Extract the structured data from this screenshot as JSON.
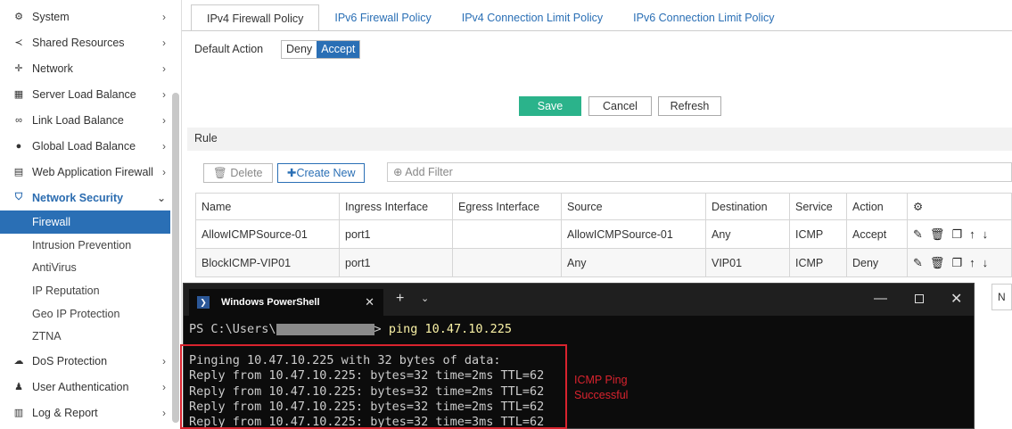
{
  "sidebar": {
    "items": [
      {
        "label": "System",
        "icon": "gear-icon"
      },
      {
        "label": "Shared Resources",
        "icon": "share-icon"
      },
      {
        "label": "Network",
        "icon": "network-icon"
      },
      {
        "label": "Server Load Balance",
        "icon": "server-load-icon"
      },
      {
        "label": "Link Load Balance",
        "icon": "link-icon"
      },
      {
        "label": "Global Load Balance",
        "icon": "globe-icon"
      },
      {
        "label": "Web Application Firewall",
        "icon": "waf-icon"
      },
      {
        "label": "Network Security",
        "icon": "shield-icon"
      }
    ],
    "sub_items": [
      "Firewall",
      "Intrusion Prevention",
      "AntiVirus",
      "IP Reputation",
      "Geo IP Protection",
      "ZTNA"
    ],
    "bottom_items": [
      {
        "label": "DoS Protection",
        "icon": "cloud-icon"
      },
      {
        "label": "User Authentication",
        "icon": "user-icon"
      },
      {
        "label": "Log & Report",
        "icon": "chart-icon"
      }
    ]
  },
  "tabs": [
    "IPv4 Firewall Policy",
    "IPv6 Firewall Policy",
    "IPv4 Connection Limit Policy",
    "IPv6 Connection Limit Policy"
  ],
  "default_action": {
    "label": "Default Action",
    "options": [
      "Deny",
      "Accept"
    ],
    "selected": "Accept"
  },
  "buttons": {
    "save": "Save",
    "cancel": "Cancel",
    "refresh": "Refresh"
  },
  "rule": {
    "title": "Rule",
    "delete": "Delete",
    "create": "Create New",
    "filter": "Add Filter",
    "columns": [
      "Name",
      "Ingress Interface",
      "Egress Interface",
      "Source",
      "Destination",
      "Service",
      "Action"
    ],
    "rows": [
      {
        "name": "AllowICMPSource-01",
        "ingress": "port1",
        "egress": "",
        "source": "AllowICMPSource-01",
        "destination": "Any",
        "service": "ICMP",
        "action": "Accept"
      },
      {
        "name": "BlockICMP-VIP01",
        "ingress": "port1",
        "egress": "",
        "source": "Any",
        "destination": "VIP01",
        "service": "ICMP",
        "action": "Deny"
      }
    ],
    "pager_fragment": "N"
  },
  "powershell": {
    "title": "Windows PowerShell",
    "prompt_prefix": "PS C:\\Users\\",
    "prompt_suffix": "> ",
    "command": "ping 10.47.10.225",
    "output": [
      "Pinging 10.47.10.225 with 32 bytes of data:",
      "Reply from 10.47.10.225: bytes=32 time=2ms TTL=62",
      "Reply from 10.47.10.225: bytes=32 time=2ms TTL=62",
      "Reply from 10.47.10.225: bytes=32 time=2ms TTL=62",
      "Reply from 10.47.10.225: bytes=32 time=3ms TTL=62"
    ]
  },
  "annotation": "ICMP Ping\nSuccessful",
  "colors": {
    "accent": "#2a6fb5",
    "save": "#2bb38b",
    "highlight": "#d9232e"
  }
}
